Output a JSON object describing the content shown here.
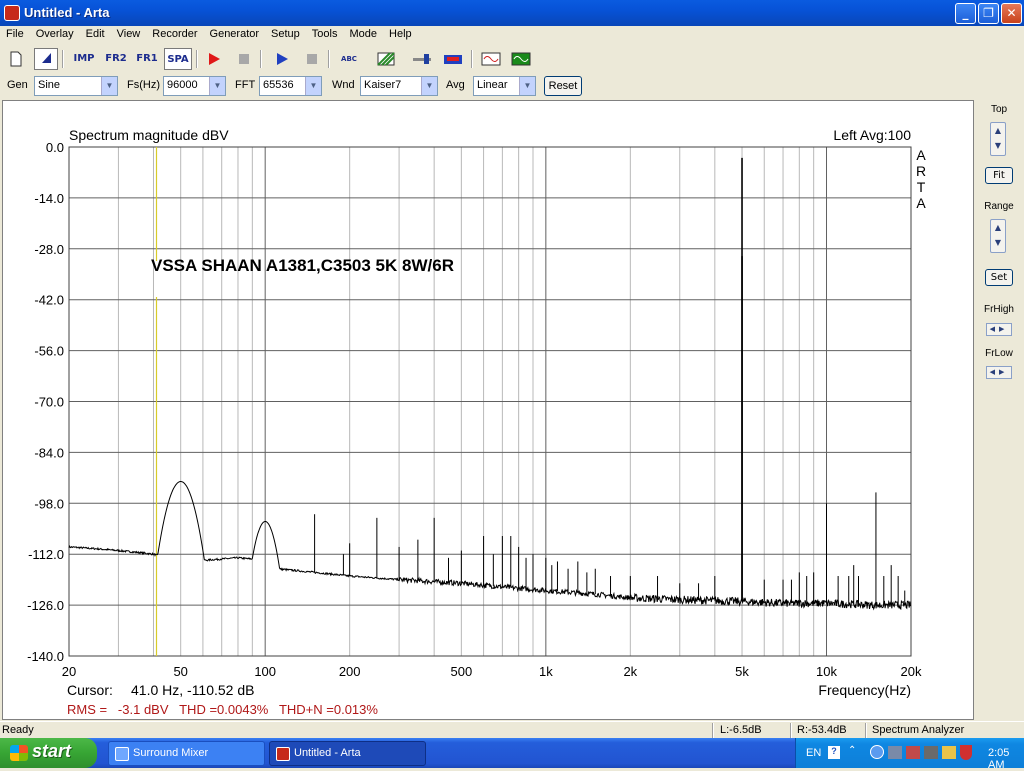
{
  "window": {
    "title": "Untitled - Arta"
  },
  "menu": [
    "File",
    "Overlay",
    "Edit",
    "View",
    "Recorder",
    "Generator",
    "Setup",
    "Tools",
    "Mode",
    "Help"
  ],
  "toolbar": {
    "imp": "IMP",
    "fr2": "FR2",
    "fr1": "FR1",
    "spa": "SPA",
    "abc": "ABC"
  },
  "params": {
    "gen_label": "Gen",
    "gen_value": "Sine",
    "fs_label": "Fs(Hz)",
    "fs_value": "96000",
    "fft_label": "FFT",
    "fft_value": "65536",
    "wnd_label": "Wnd",
    "wnd_value": "Kaiser7",
    "avg_label": "Avg",
    "avg_value": "Linear",
    "reset_label": "Reset"
  },
  "chart_panel": {
    "cursor_label": "Cursor:",
    "cursor_value": "41.0 Hz, -110.52 dB",
    "stats": "RMS =   -3.1 dBV   THD =0.0043%   THD+N =0.013%",
    "channel_avg": "Left   Avg:100",
    "brand": "ARTA"
  },
  "chart_data": {
    "type": "line",
    "title": "Spectrum magnitude dBV",
    "annotation": "VSSA SHAAN A1381,C3503 5K 8W/6R",
    "xlabel": "Frequency(Hz)",
    "ylabel": "",
    "xscale": "log",
    "xlim": [
      20,
      20000
    ],
    "ylim": [
      -140,
      0
    ],
    "x_ticks": [
      20,
      50,
      100,
      200,
      500,
      1000,
      2000,
      5000,
      10000,
      20000
    ],
    "x_tick_labels": [
      "20",
      "50",
      "100",
      "200",
      "500",
      "1k",
      "2k",
      "5k",
      "10k",
      "20k"
    ],
    "y_ticks": [
      0,
      -14,
      -28,
      -42,
      -56,
      -70,
      -84,
      -98,
      -112,
      -126,
      -140
    ],
    "y_tick_labels": [
      "0.0",
      "-14.0",
      "-28.0",
      "-42.0",
      "-56.0",
      "-70.0",
      "-84.0",
      "-98.0",
      "-112.0",
      "-126.0",
      "-140.0"
    ],
    "grid": true,
    "cursor_hz": 41.0,
    "noise_floor": [
      [
        20,
        -110
      ],
      [
        25,
        -110.5
      ],
      [
        30,
        -111
      ],
      [
        35,
        -111.5
      ],
      [
        40,
        -112
      ],
      [
        44,
        -113
      ],
      [
        55,
        -114
      ],
      [
        65,
        -113.5
      ],
      [
        80,
        -113
      ],
      [
        95,
        -113.5
      ],
      [
        110,
        -116
      ],
      [
        150,
        -117
      ],
      [
        200,
        -118
      ],
      [
        300,
        -119
      ],
      [
        500,
        -120
      ],
      [
        700,
        -121
      ],
      [
        1000,
        -122
      ],
      [
        1500,
        -123
      ],
      [
        2000,
        -124
      ],
      [
        3000,
        -124.5
      ],
      [
        5000,
        -125
      ],
      [
        7000,
        -125.5
      ],
      [
        10000,
        -125.5
      ],
      [
        15000,
        -126
      ],
      [
        20000,
        -126
      ]
    ],
    "peaks": [
      [
        50,
        -92
      ],
      [
        100,
        -103
      ],
      [
        150,
        -101
      ],
      [
        190,
        -112
      ],
      [
        200,
        -109
      ],
      [
        250,
        -102
      ],
      [
        300,
        -110
      ],
      [
        350,
        -108
      ],
      [
        400,
        -102
      ],
      [
        450,
        -113
      ],
      [
        500,
        -111
      ],
      [
        600,
        -107
      ],
      [
        650,
        -112
      ],
      [
        700,
        -107
      ],
      [
        750,
        -107
      ],
      [
        800,
        -110
      ],
      [
        850,
        -113
      ],
      [
        900,
        -112
      ],
      [
        1000,
        -113
      ],
      [
        1050,
        -115
      ],
      [
        1100,
        -114
      ],
      [
        1200,
        -116
      ],
      [
        1300,
        -114
      ],
      [
        1400,
        -117
      ],
      [
        1500,
        -116
      ],
      [
        1700,
        -118
      ],
      [
        2000,
        -118
      ],
      [
        2500,
        -118
      ],
      [
        3000,
        -120
      ],
      [
        3500,
        -120
      ],
      [
        4000,
        -118
      ],
      [
        5000,
        -3
      ],
      [
        5001,
        -30
      ],
      [
        6000,
        -119
      ],
      [
        7000,
        -119
      ],
      [
        7500,
        -119
      ],
      [
        8000,
        -117
      ],
      [
        8500,
        -118
      ],
      [
        9000,
        -117
      ],
      [
        10000,
        -98
      ],
      [
        11000,
        -118
      ],
      [
        12000,
        -118
      ],
      [
        12500,
        -115
      ],
      [
        13000,
        -118
      ],
      [
        15000,
        -95
      ],
      [
        16000,
        -118
      ],
      [
        17000,
        -115
      ],
      [
        18000,
        -118
      ],
      [
        19000,
        -122
      ]
    ]
  },
  "right_panel": {
    "top_label": "Top",
    "fit_label": "Fit",
    "range_label": "Range",
    "set_label": "Set",
    "frhigh_label": "FrHigh",
    "frlow_label": "FrLow"
  },
  "status": {
    "ready": "Ready",
    "left_level": "L:-6.5dB",
    "right_level": "R:-53.4dB",
    "mode": "Spectrum Analyzer"
  },
  "taskbar": {
    "start": "start",
    "tasks": [
      "Surround Mixer",
      "Untitled - Arta"
    ],
    "lang": "EN",
    "clock": "2:05 AM"
  },
  "colors": {
    "cursor_line": "#d8cc2a",
    "stats_text": "#b01818",
    "trace": "#000000"
  }
}
